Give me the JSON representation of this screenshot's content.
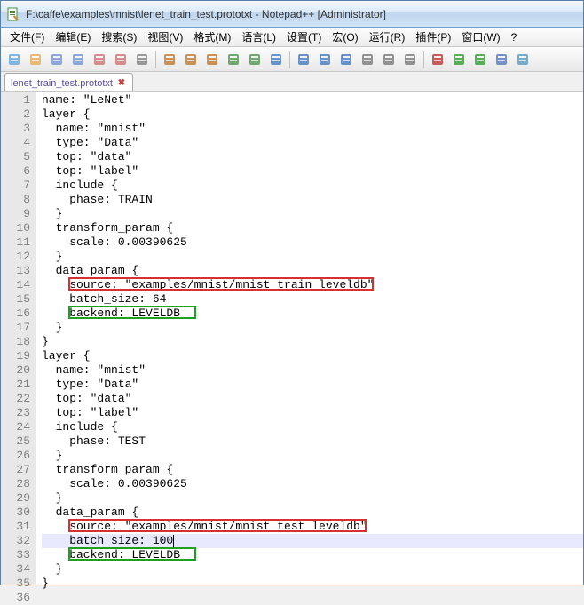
{
  "title": "F:\\caffe\\examples\\mnist\\lenet_train_test.prototxt - Notepad++ [Administrator]",
  "menu": {
    "items": [
      "文件(F)",
      "编辑(E)",
      "搜索(S)",
      "视图(V)",
      "格式(M)",
      "语言(L)",
      "设置(T)",
      "宏(O)",
      "运行(R)",
      "插件(P)",
      "窗口(W)",
      "?"
    ]
  },
  "toolbar_icons": [
    "new-file-icon",
    "open-file-icon",
    "save-icon",
    "save-all-icon",
    "close-icon",
    "close-all-icon",
    "print-icon",
    "cut-icon",
    "copy-icon",
    "paste-icon",
    "undo-icon",
    "redo-icon",
    "find-icon",
    "replace-icon",
    "zoom-in-icon",
    "zoom-out-icon",
    "wrap-icon",
    "show-all-chars-icon",
    "indent-guide-icon",
    "macro-record-icon",
    "macro-play-icon",
    "macro-play-multi-icon",
    "macro-save-icon",
    "eye-icon"
  ],
  "tab": {
    "label": "lenet_train_test.prototxt",
    "close_glyph": "✖"
  },
  "code_lines": [
    "name: \"LeNet\"",
    "layer {",
    "  name: \"mnist\"",
    "  type: \"Data\"",
    "  top: \"data\"",
    "  top: \"label\"",
    "  include {",
    "    phase: TRAIN",
    "  }",
    "  transform_param {",
    "    scale: 0.00390625",
    "  }",
    "  data_param {",
    "    source: \"examples/mnist/mnist_train_leveldb\"",
    "    batch_size: 64",
    "    backend: LEVELDB",
    "  }",
    "}",
    "layer {",
    "  name: \"mnist\"",
    "  type: \"Data\"",
    "  top: \"data\"",
    "  top: \"label\"",
    "  include {",
    "    phase: TEST",
    "  }",
    "  transform_param {",
    "    scale: 0.00390625",
    "  }",
    "  data_param {",
    "    source: \"examples/mnist/mnist_test_leveldb\"",
    "    batch_size: 100",
    "    backend: LEVELDB",
    "  }",
    "}"
  ],
  "current_line_index": 31,
  "highlights": {
    "red": [
      {
        "line": 13,
        "left_ch": 4,
        "width_ch": 43
      },
      {
        "line": 30,
        "left_ch": 4,
        "width_ch": 42
      }
    ],
    "green": [
      {
        "line": 15,
        "left_ch": 4,
        "width_ch": 18
      },
      {
        "line": 32,
        "left_ch": 4,
        "width_ch": 18
      }
    ]
  }
}
